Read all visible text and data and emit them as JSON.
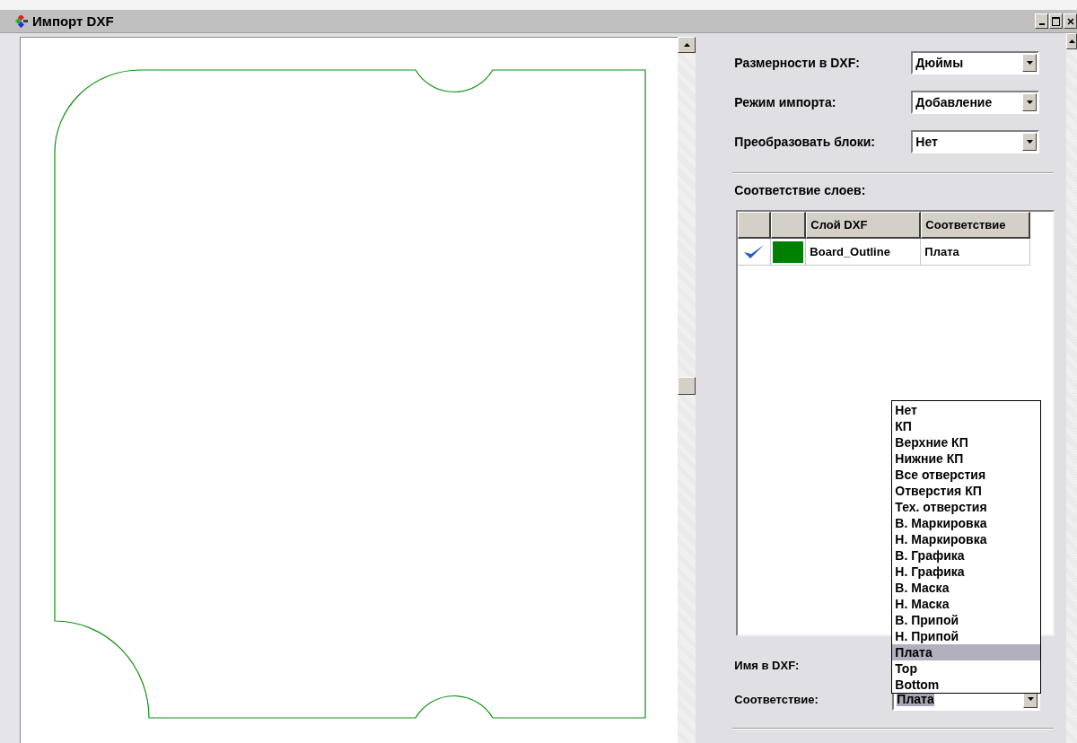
{
  "window": {
    "title": "Импорт DXF"
  },
  "settings": [
    {
      "label": "Размерности в DXF:",
      "value": "Дюймы"
    },
    {
      "label": "Режим импорта:",
      "value": "Добавление"
    },
    {
      "label": "Преобразовать блоки:",
      "value": "Нет"
    }
  ],
  "layer_mapping": {
    "label": "Соответствие слоев:",
    "columns": [
      "Слой DXF",
      "Соответствие"
    ],
    "rows": [
      {
        "checked": true,
        "color": "#008000",
        "layer": "Board_Outline",
        "mapping": "Плата"
      }
    ]
  },
  "dropdown": {
    "items": [
      {
        "label": "Нет",
        "selected": false
      },
      {
        "label": "КП",
        "selected": false
      },
      {
        "label": "Верхние КП",
        "selected": false
      },
      {
        "label": "Нижние КП",
        "selected": false
      },
      {
        "label": "Все отверстия",
        "selected": false
      },
      {
        "label": "Отверстия КП",
        "selected": false
      },
      {
        "label": "Тех. отверстия",
        "selected": false
      },
      {
        "label": "В. Маркировка",
        "selected": false
      },
      {
        "label": "Н. Маркировка",
        "selected": false
      },
      {
        "label": "В. Графика",
        "selected": false
      },
      {
        "label": "Н. Графика",
        "selected": false
      },
      {
        "label": "В. Маска",
        "selected": false
      },
      {
        "label": "Н. Маска",
        "selected": false
      },
      {
        "label": "В. Припой",
        "selected": false
      },
      {
        "label": "Н. Припой",
        "selected": false
      },
      {
        "label": "Плата",
        "selected": true
      },
      {
        "label": "Top",
        "selected": false
      },
      {
        "label": "Bottom",
        "selected": false
      }
    ]
  },
  "name_field": {
    "label": "Имя в DXF:"
  },
  "mapping_field": {
    "label": "Соответствие:",
    "value": "Плата"
  }
}
